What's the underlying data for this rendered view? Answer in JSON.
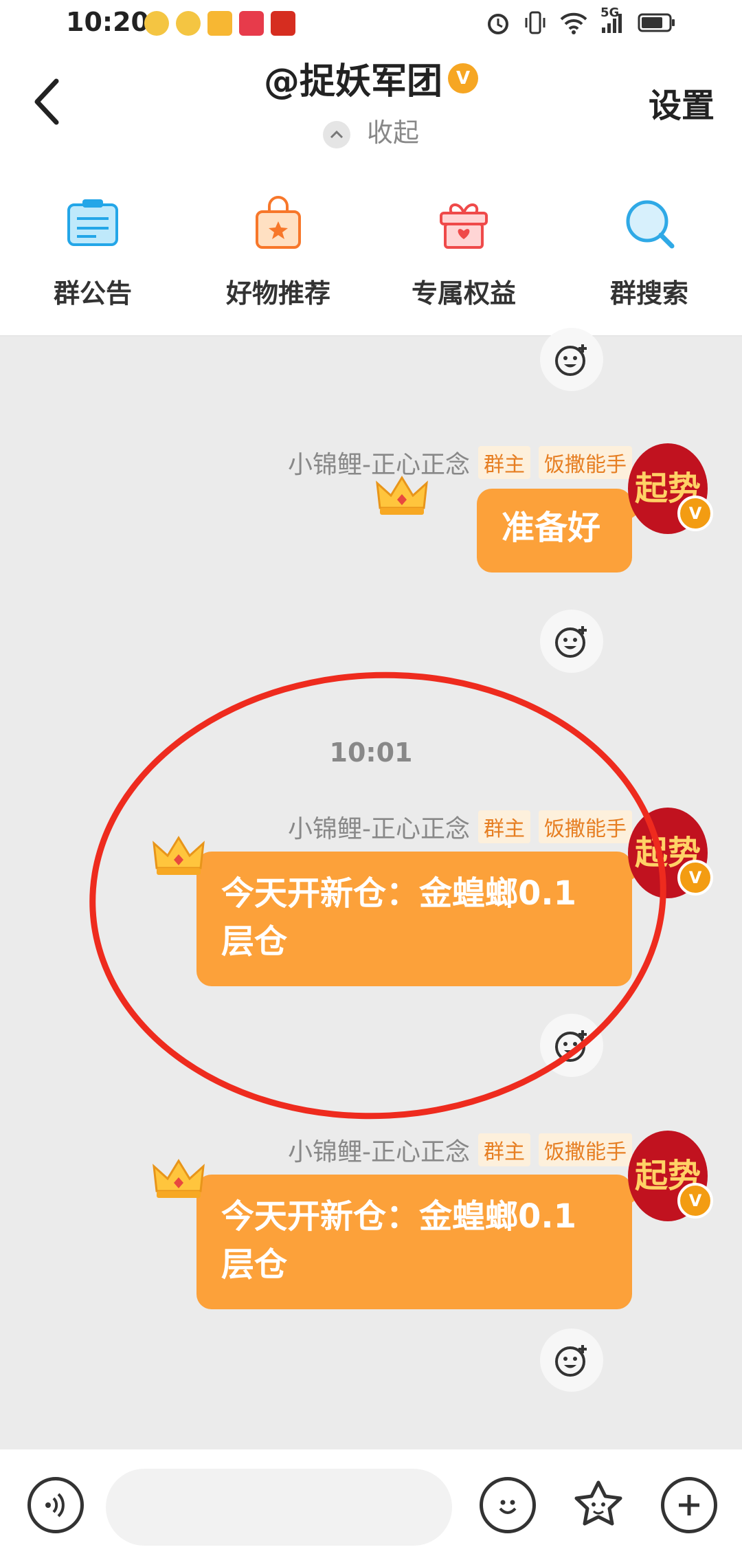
{
  "status_bar": {
    "time": "10:20",
    "network": "5G"
  },
  "header": {
    "title": "@捉妖军团",
    "verified_badge": "V",
    "collapse_label": "收起",
    "settings_label": "设置"
  },
  "quick_actions": [
    {
      "label": "群公告",
      "icon": "announcement-icon"
    },
    {
      "label": "好物推荐",
      "icon": "shopping-bag-icon"
    },
    {
      "label": "专属权益",
      "icon": "gift-icon"
    },
    {
      "label": "群搜索",
      "icon": "search-icon"
    }
  ],
  "chat": {
    "timestamp": "10:01",
    "messages": [
      {
        "sender": "小锦鲤-正心正念",
        "tags": [
          "群主",
          "饭撒能手"
        ],
        "text": "准备好",
        "avatar_text": "起势"
      },
      {
        "sender": "小锦鲤-正心正念",
        "tags": [
          "群主",
          "饭撒能手"
        ],
        "text": "今天开新仓：金蝗螂0.1层仓",
        "avatar_text": "起势"
      },
      {
        "sender": "小锦鲤-正心正念",
        "tags": [
          "群主",
          "饭撒能手"
        ],
        "text": "今天开新仓：金蝗螂0.1层仓",
        "avatar_text": "起势"
      }
    ]
  },
  "input_bar": {
    "placeholder": ""
  },
  "colors": {
    "bubble": "#fca13a",
    "annotation_circle": "#ee2b1e",
    "tag_text": "#e67e22"
  }
}
